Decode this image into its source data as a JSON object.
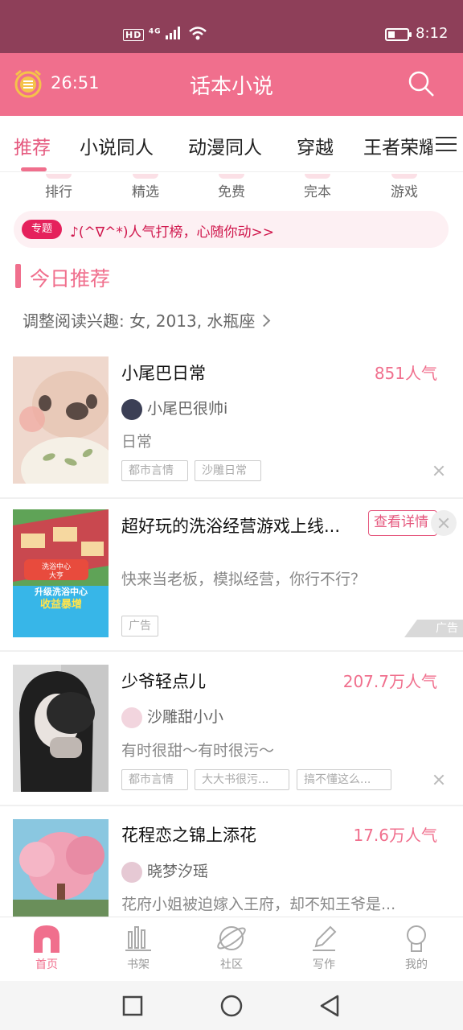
{
  "status_bar": {
    "network": "HD",
    "signal": "4G",
    "time": "8:12"
  },
  "header": {
    "timer": "26:51",
    "title": "话本小说",
    "icons": [
      "alarm-clock-icon",
      "search-icon"
    ]
  },
  "tabs": [
    "推荐",
    "小说同人",
    "动漫同人",
    "穿越",
    "王者荣耀"
  ],
  "quick_links": [
    "排行",
    "精选",
    "免费",
    "完本",
    "游戏"
  ],
  "topic": {
    "badge": "专题",
    "text": "♪(^∇^*)人气打榜，心随你动>>"
  },
  "section": {
    "title": "今日推荐",
    "interest": "调整阅读兴趣: 女, 2013, 水瓶座"
  },
  "books": [
    {
      "title": "小尾巴日常",
      "popularity": "851人气",
      "author": "小尾巴很帅i",
      "desc": "日常",
      "tags": [
        "都市言情",
        "沙雕日常"
      ]
    },
    {
      "title": "少爷轻点儿",
      "popularity": "207.7万人气",
      "author": "沙雕甜小小",
      "desc": "有时很甜～有时很污～",
      "tags": [
        "都市言情",
        "大大书很污...",
        "搞不懂这么..."
      ]
    },
    {
      "title": "花程恋之锦上添花",
      "popularity": "17.6万人气",
      "author": "晓梦汐瑶",
      "desc": "花府小姐被迫嫁入王府，却不知王爷是..."
    }
  ],
  "ad": {
    "title": "超好玩的洗浴经营游戏上线...",
    "button": "查看详情",
    "desc": "快来当老板，模拟经营，你行不行？",
    "tag": "广告",
    "corner": "广告",
    "cover_text": [
      "洗浴中心",
      "大亨",
      "升级洗浴中心",
      "收益暴增"
    ]
  },
  "bottom_nav": [
    {
      "label": "首页",
      "icon": "home-icon"
    },
    {
      "label": "书架",
      "icon": "bookshelf-icon"
    },
    {
      "label": "社区",
      "icon": "planet-icon"
    },
    {
      "label": "写作",
      "icon": "pen-icon"
    },
    {
      "label": "我的",
      "icon": "profile-icon"
    }
  ],
  "colors": {
    "accent": "#f06f8d",
    "status_bar": "#8e3f59",
    "topic_badge": "#e5215c"
  }
}
